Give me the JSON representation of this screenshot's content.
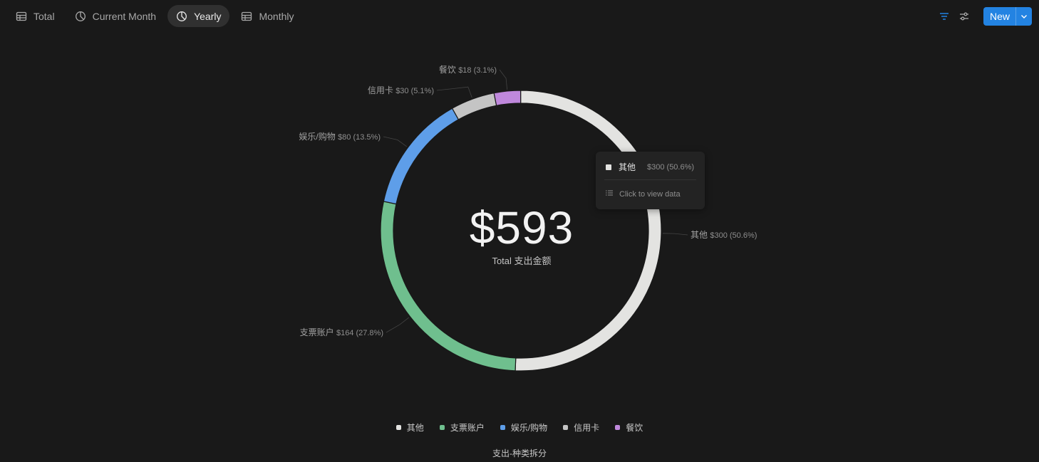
{
  "tabs": [
    {
      "label": "Total",
      "icon": "table-icon",
      "active": false
    },
    {
      "label": "Current Month",
      "icon": "pie-icon",
      "active": false
    },
    {
      "label": "Yearly",
      "icon": "pie-icon",
      "active": true
    },
    {
      "label": "Monthly",
      "icon": "table-icon",
      "active": false
    }
  ],
  "toolbar": {
    "new_label": "New",
    "filter_color": "#2383e2",
    "accent": "#2383e2"
  },
  "center": {
    "value": "$593",
    "label": "Total 支出金额"
  },
  "tooltip": {
    "name": "其他",
    "value": "$300 (50.6%)",
    "link": "Click to view data"
  },
  "chart_data": {
    "type": "pie",
    "variant": "donut",
    "title": "支出-种类拆分",
    "total": 593,
    "legend_position": "bottom",
    "slices": [
      {
        "name": "其他",
        "value": 300,
        "label": "$300 (50.6%)",
        "color": "#e3e3e1"
      },
      {
        "name": "支票账户",
        "value": 164,
        "label": "$164 (27.8%)",
        "color": "#6fbf8e"
      },
      {
        "name": "娱乐/购物",
        "value": 80,
        "label": "$80 (13.5%)",
        "color": "#5e9ee9"
      },
      {
        "name": "信用卡",
        "value": 30,
        "label": "$30 (5.1%)",
        "color": "#c4c4c4"
      },
      {
        "name": "餐饮",
        "value": 18,
        "label": "$18 (3.1%)",
        "color": "#bf88dc"
      }
    ]
  }
}
